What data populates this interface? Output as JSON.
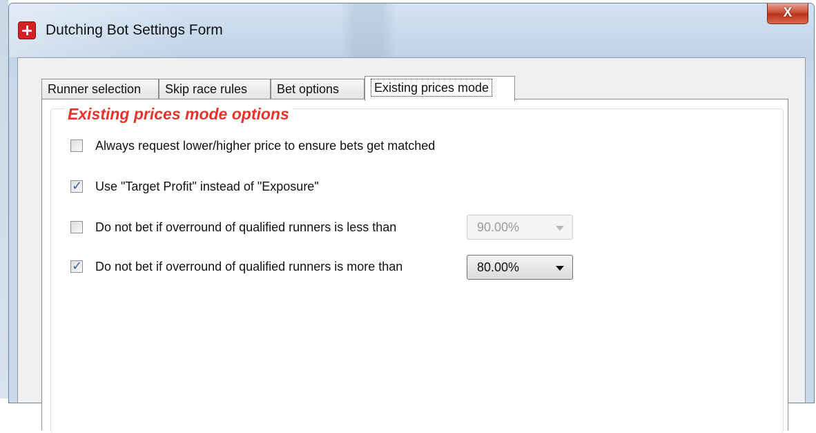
{
  "window": {
    "title": "Dutching Bot Settings Form",
    "close_label": "X"
  },
  "tabs": [
    {
      "label": "Runner selection",
      "active": false
    },
    {
      "label": "Skip race rules",
      "active": false
    },
    {
      "label": "Bet options",
      "active": false
    },
    {
      "label": "Existing prices mode",
      "active": true
    }
  ],
  "group": {
    "title": "Existing prices mode options"
  },
  "options": [
    {
      "label": "Always request lower/higher price to ensure bets get matched",
      "checked": false
    },
    {
      "label": "Use \"Target Profit\" instead of \"Exposure\"",
      "checked": true
    },
    {
      "label": "Do not bet if overround of qualified runners is less than",
      "checked": false,
      "dropdown": {
        "value": "90.00%",
        "enabled": false
      }
    },
    {
      "label": "Do not bet if overround of qualified runners is more than",
      "checked": true,
      "dropdown": {
        "value": "80.00%",
        "enabled": true
      }
    }
  ],
  "colors": {
    "group_title": "#e8332a",
    "checkmark": "#3c5fa0",
    "app_icon": "#d42222",
    "close_button": "#c7452c"
  },
  "icons": {
    "app": "dutching-bot-app-icon",
    "close": "close-icon",
    "check": "checkmark-icon",
    "dropdown": "chevron-down-icon"
  }
}
